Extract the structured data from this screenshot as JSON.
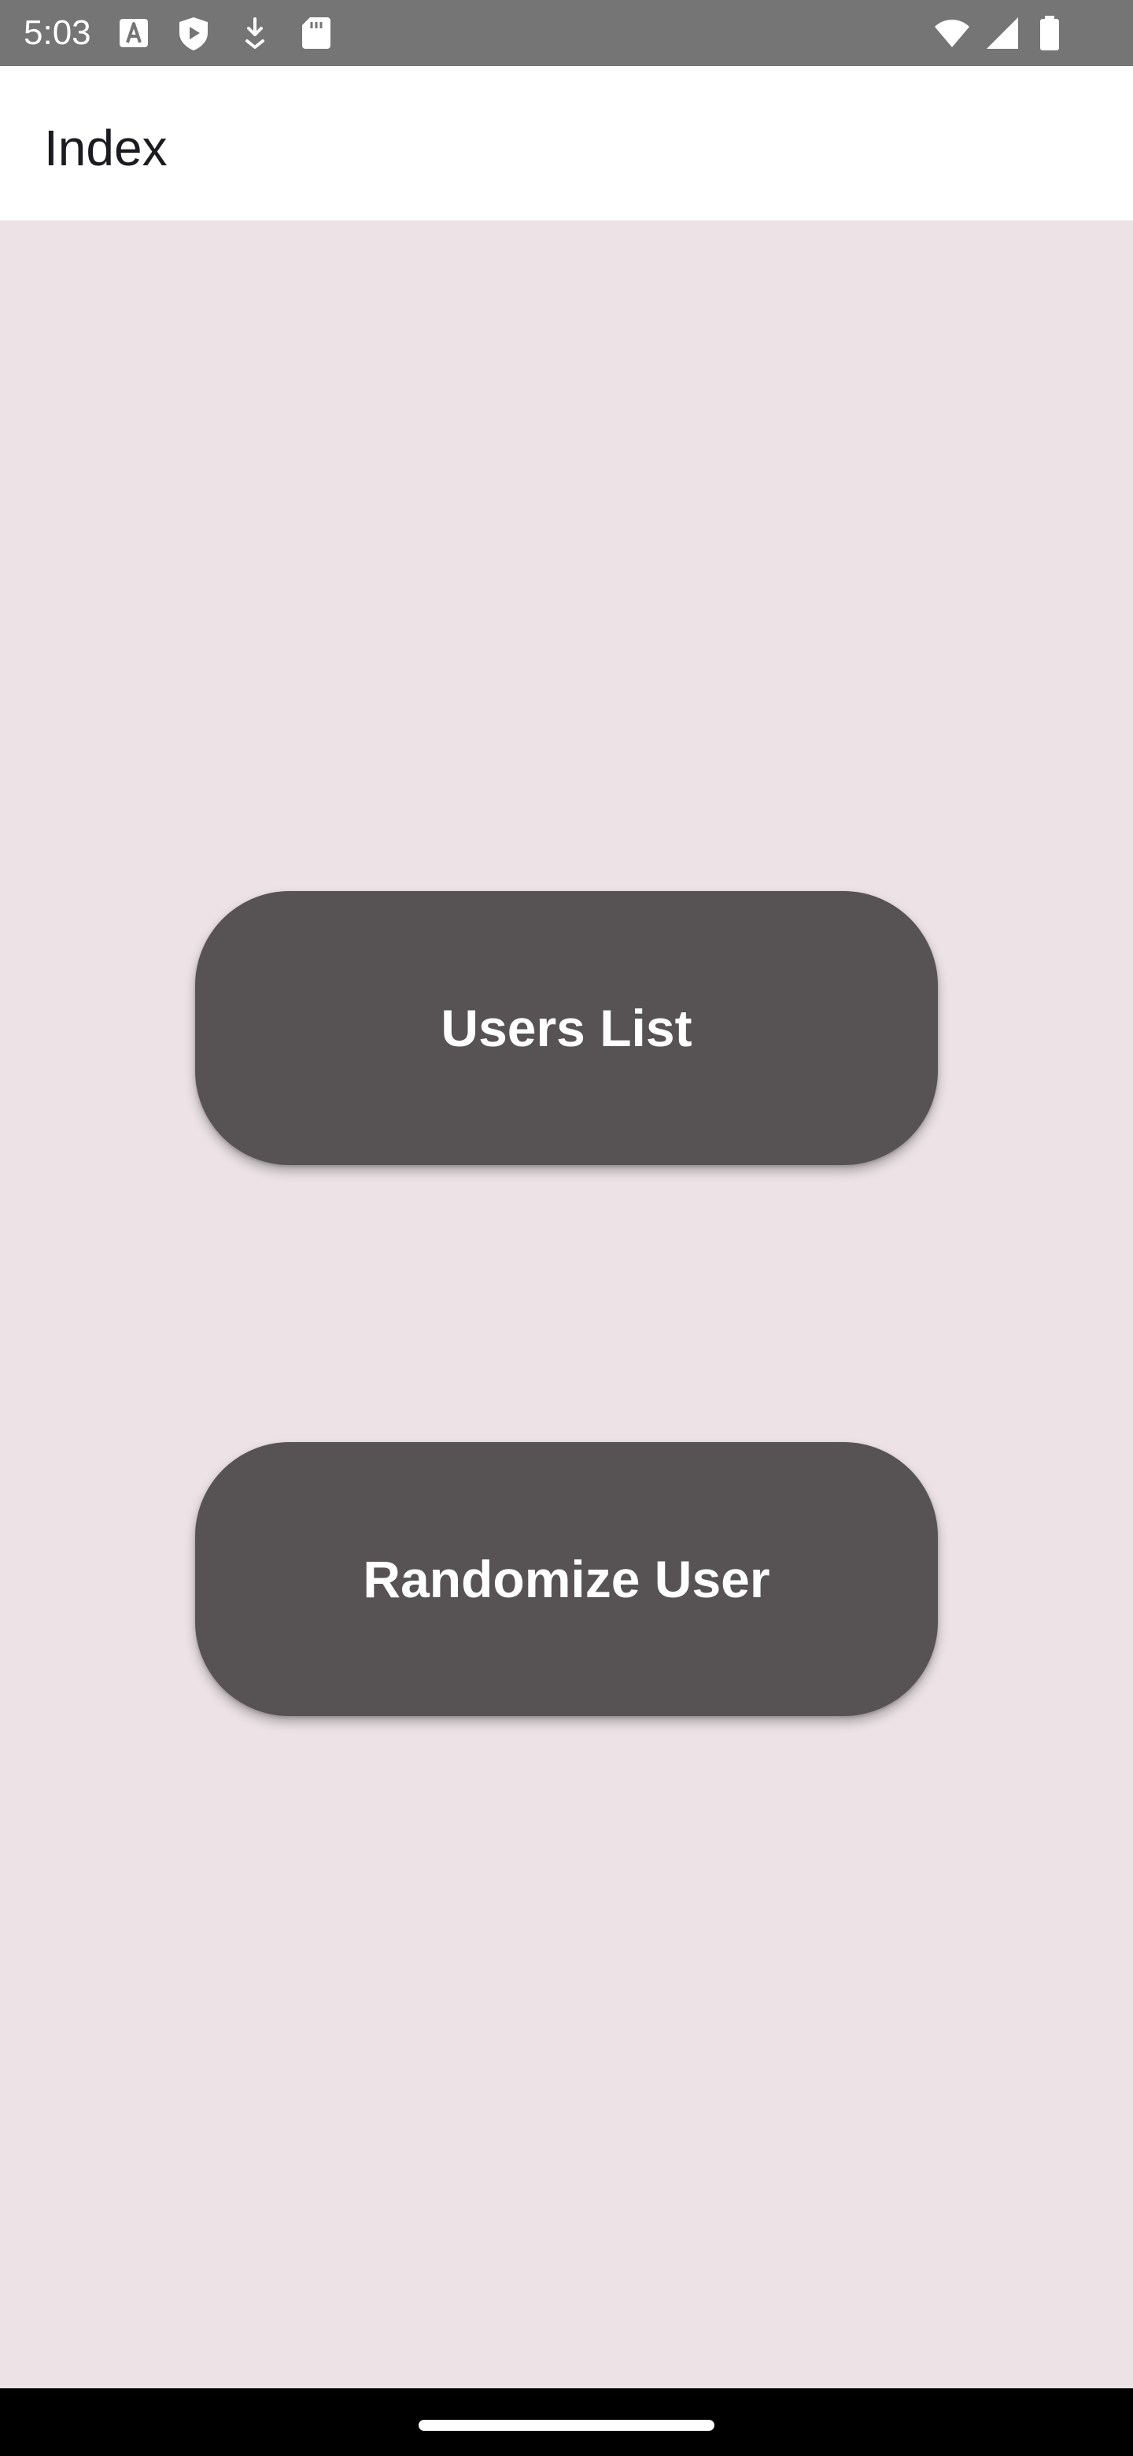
{
  "status_bar": {
    "time": "5:03",
    "icons_left": [
      "text-a-icon",
      "shield-play-icon",
      "download-icon",
      "sd-card-icon"
    ],
    "icons_right": [
      "wifi-icon",
      "signal-icon",
      "battery-icon"
    ],
    "background": "#757575"
  },
  "app_bar": {
    "title": "Index"
  },
  "main": {
    "background": "#ede3e7",
    "buttons": [
      {
        "label": "Users List",
        "color": "#575355"
      },
      {
        "label": "Randomize User",
        "color": "#575355"
      }
    ]
  },
  "nav_bar": {
    "handle": "home-handle"
  }
}
